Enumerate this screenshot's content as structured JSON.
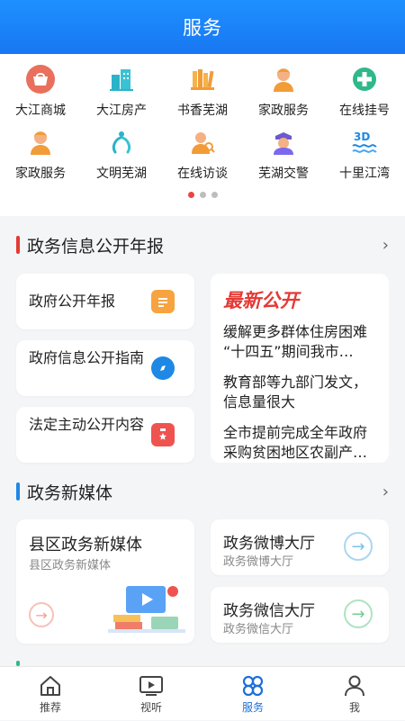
{
  "header": {
    "title": "服务"
  },
  "grid": {
    "items": [
      {
        "label": "大江商城",
        "icon": "mall-icon"
      },
      {
        "label": "大江房产",
        "icon": "building-icon"
      },
      {
        "label": "书香芜湖",
        "icon": "books-icon"
      },
      {
        "label": "家政服务",
        "icon": "housekeeper-icon"
      },
      {
        "label": "在线挂号",
        "icon": "medical-cross-icon"
      },
      {
        "label": "家政服务",
        "icon": "housekeeper-icon"
      },
      {
        "label": "文明芜湖",
        "icon": "hands-icon"
      },
      {
        "label": "在线访谈",
        "icon": "interview-icon"
      },
      {
        "label": "芜湖交警",
        "icon": "police-icon"
      },
      {
        "label": "十里江湾",
        "icon": "3d-waves-icon"
      }
    ]
  },
  "section1": {
    "title": "政务信息公开年报",
    "cards": [
      {
        "label": "政府公开年报"
      },
      {
        "label": "政府信息公开指南"
      },
      {
        "label": "法定主动公开内容"
      }
    ],
    "latest": {
      "heading": "最新公开",
      "news": [
        "缓解更多群体住房困难 “十四五”期间我市…",
        "教育部等九部门发文，信息量很大",
        "全市提前完成全年政府采购贫困地区农副产…"
      ]
    }
  },
  "section2": {
    "title": "政务新媒体",
    "county": {
      "title": "县区政务新媒体",
      "subtitle": "县区政务新媒体"
    },
    "weibo": {
      "title": "政务微博大厅",
      "subtitle": "政务微博大厅"
    },
    "wechat": {
      "title": "政务微信大厅",
      "subtitle": "政务微信大厅"
    }
  },
  "tabbar": {
    "tabs": [
      {
        "label": "推荐",
        "icon": "home-icon"
      },
      {
        "label": "视听",
        "icon": "video-icon"
      },
      {
        "label": "服务",
        "icon": "service-grid-icon"
      },
      {
        "label": "我",
        "icon": "user-icon"
      }
    ],
    "active_index": 2
  },
  "colors": {
    "accent": "#1e6fd9",
    "red": "#e53935"
  }
}
